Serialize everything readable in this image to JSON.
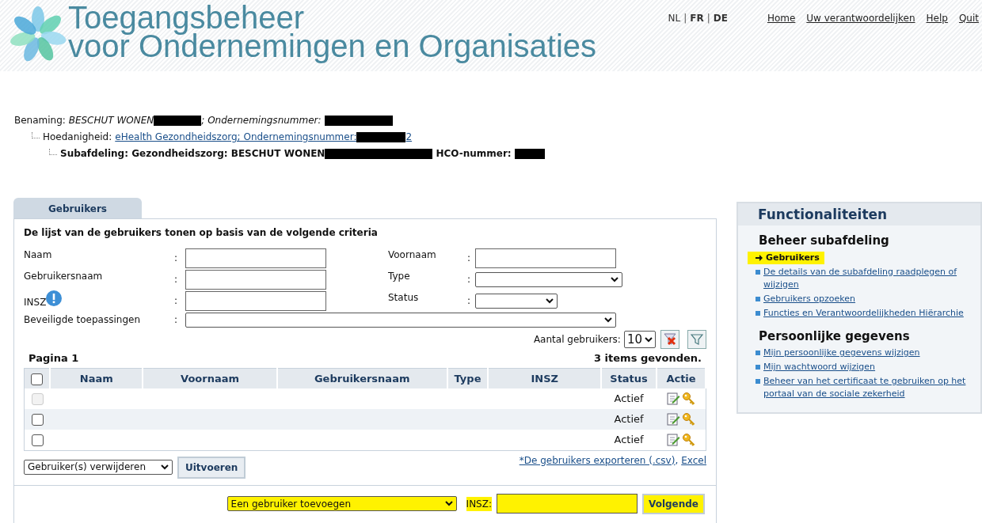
{
  "header": {
    "title_line1": "Toegangsbeheer",
    "title_line2": "voor Ondernemingen en Organisaties",
    "languages": [
      {
        "label": "NL",
        "selected": false
      },
      {
        "separator": "|",
        "label": "FR",
        "selected": true
      },
      {
        "separator": "|",
        "label": "DE",
        "selected": true
      }
    ],
    "nav": [
      "Home",
      "Uw verantwoordelijken",
      "Help",
      "Quit"
    ]
  },
  "breadcrumb": [
    {
      "kind": "plain",
      "label": "Benaming:",
      "value": "BESCHUT WONEN",
      "redacted": true,
      "label2": "; Ondernemingsnummer:",
      "redacted2": true
    },
    {
      "kind": "link",
      "label": "Hoedanigheid:",
      "value": "eHealth Gezondheidszorg; Ondernemingsnummer:",
      "redacted": true,
      "tail": "2"
    },
    {
      "kind": "bold",
      "label": "Subafdeling: Gezondheidszorg: BESCHUT WONEN",
      "redacted": true,
      "label2": "HCO-nummer:",
      "redacted2": true
    }
  ],
  "tab": {
    "label": "Gebruikers",
    "selected": true
  },
  "criteria": {
    "heading": "De lijst van de gebruikers tonen op basis van de volgende criteria",
    "left": [
      {
        "label": "Naam",
        "colon": ":",
        "kind": "text"
      },
      {
        "label": "Gebruikersnaam",
        "colon": ":",
        "kind": "text"
      },
      {
        "label": "INSZ",
        "colon": ":",
        "kind": "text",
        "info": true
      }
    ],
    "right": [
      {
        "label": "Voornaam",
        "colon": ":",
        "kind": "text"
      },
      {
        "label": "Type",
        "colon": ":",
        "kind": "select"
      },
      {
        "label": "Status",
        "colon": ":",
        "kind": "select"
      }
    ],
    "wide": {
      "label": "Beveiligde toepassingen",
      "colon": ":",
      "kind": "select"
    },
    "count_label": "Aantal gebruikers:",
    "count_value": "10"
  },
  "table": {
    "page": "Pagina 1",
    "found": "3 items gevonden.",
    "select_all_checked": false,
    "columns": [
      "Naam",
      "Voornaam",
      "Gebruikersnaam",
      "Type",
      "INSZ",
      "Status",
      "Actie"
    ],
    "rows": [
      {
        "disabled": true,
        "checked": false,
        "status": "Actief"
      },
      {
        "disabled": false,
        "checked": false,
        "status": "Actief"
      },
      {
        "disabled": false,
        "checked": false,
        "status": "Actief"
      }
    ]
  },
  "bulk": {
    "action": "Gebruiker(s) verwijderen",
    "button": "Uitvoeren",
    "export_link": "*De gebruikers exporteren (.csv)",
    "separator": ",",
    "excel_link": "Excel"
  },
  "add": {
    "action": "Een gebruiker toevoegen",
    "insz_label": "INSZ:",
    "button": "Volgende",
    "highlighted": true
  },
  "sidebar": {
    "title": "Functionaliteiten",
    "sections": [
      {
        "heading": "Beheer subafdeling",
        "items": [
          {
            "label": "Gebruikers",
            "selected": true
          },
          {
            "label": "De details van de subafdeling raadplegen of wijzigen",
            "selected": false
          },
          {
            "label": "Gebruikers opzoeken",
            "selected": false
          },
          {
            "label": "Functies en Verantwoordelijkheden Hiërarchie",
            "selected": false
          }
        ]
      },
      {
        "heading": "Persoonlijke gegevens",
        "items": [
          {
            "label": "Mijn persoonlijke gegevens wijzigen",
            "selected": false
          },
          {
            "label": "Mijn wachtwoord wijzigen",
            "selected": false
          },
          {
            "label": "Beheer van het certificaat te gebruiken op het portaal van de sociale zekerheid",
            "selected": false
          }
        ]
      }
    ]
  }
}
